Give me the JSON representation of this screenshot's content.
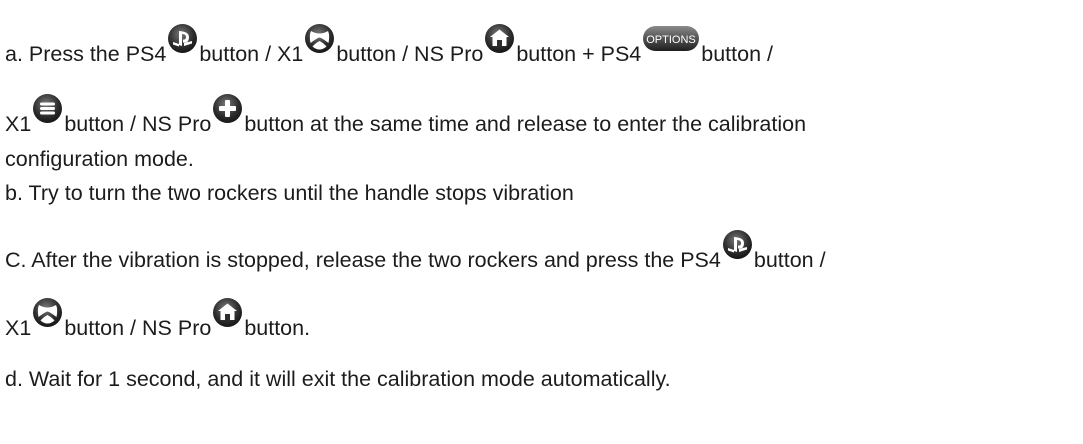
{
  "lines": [
    {
      "before_ps": "a. Press the PS4",
      "after_ps": "button / X1",
      "after_xbox": "button / NS Pro",
      "after_home": "button + PS4",
      "options_label": "OPTIONS",
      "after_options": "button /"
    },
    {
      "before_menu": "X1",
      "after_menu": "button / NS Pro",
      "after_plus": "button at the same time and release to enter the calibration"
    },
    {
      "text": "configuration mode."
    },
    {
      "text": "b. Try to turn the two rockers until the handle stops vibration"
    },
    {
      "before_ps": "C. After the vibration is stopped, release the two rockers and press the PS4",
      "after_ps": "button /"
    },
    {
      "before_xbox": "X1",
      "after_xbox": "button / NS Pro",
      "after_home": "button."
    },
    {
      "text": "d. Wait for 1 second, and it will exit the calibration mode automatically."
    }
  ],
  "icons": {
    "ps": "playstation-icon",
    "xbox": "xbox-icon",
    "home": "home-icon",
    "options": "options-icon",
    "menu": "menu-icon",
    "plus": "plus-icon"
  },
  "colors": {
    "icon_dark": "#2a2a2a",
    "icon_light": "#ffffff",
    "text": "#1c1c1c"
  }
}
